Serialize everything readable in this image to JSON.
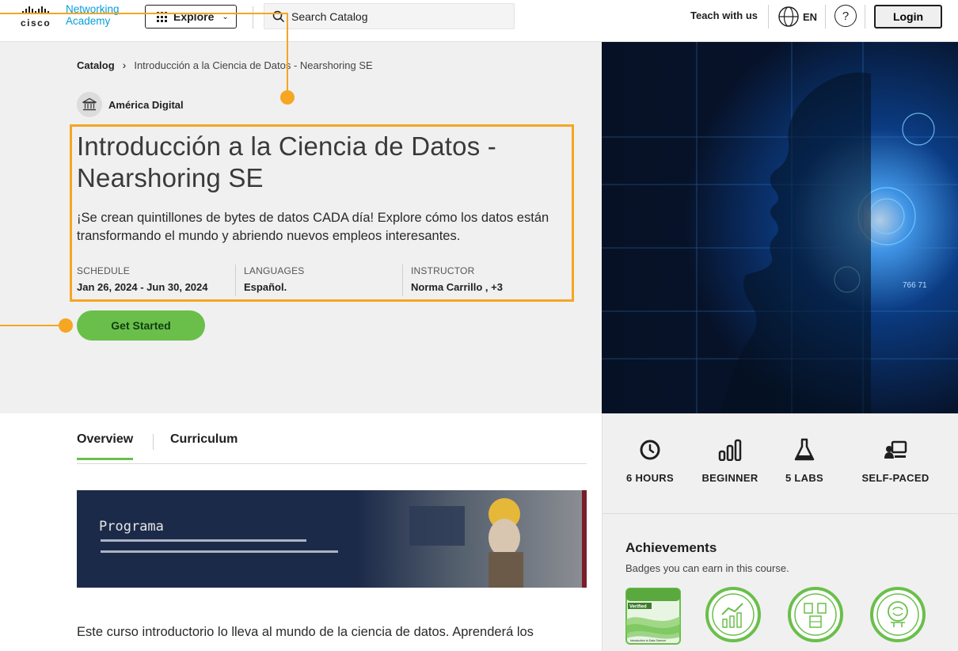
{
  "nav": {
    "logo_brand": "cisco",
    "logo_line1": "Networking",
    "logo_line2": "Academy",
    "explore_label": "Explore",
    "search_placeholder": "Search Catalog",
    "teach_label": "Teach with us",
    "language_label": "EN",
    "help_label": "?",
    "login_label": "Login"
  },
  "breadcrumb": {
    "root": "Catalog",
    "current": "Introducción a la Ciencia de Datos - Nearshoring SE"
  },
  "course": {
    "provider": "América Digital",
    "title": "Introducción a la Ciencia de Datos - Nearshoring SE",
    "description": "¡Se crean quintillones de bytes de datos CADA día! Explore cómo los datos están transformando el mundo y abriendo nuevos empleos interesantes.",
    "schedule_label": "SCHEDULE",
    "schedule_value": "Jan 26, 2024 - Jun 30, 2024",
    "languages_label": "LANGUAGES",
    "languages_value": "Español.",
    "instructor_label": "INSTRUCTOR",
    "instructor_value": "Norma Carrillo , +3",
    "cta_label": "Get Started"
  },
  "hero_image": {
    "overlay_text": "766 71"
  },
  "tabs": [
    {
      "label": "Overview",
      "active": true
    },
    {
      "label": "Curriculum",
      "active": false
    }
  ],
  "banner": {
    "title": "Programa"
  },
  "overview_text": "Este curso introductorio lo lleva al mundo de la ciencia de datos. Aprenderá los",
  "stats": [
    {
      "icon": "clock-icon",
      "label": "6 HOURS"
    },
    {
      "icon": "bar-chart-icon",
      "label": "BEGINNER"
    },
    {
      "icon": "flask-icon",
      "label": "5 LABS"
    },
    {
      "icon": "self-paced-icon",
      "label": "SELF-PACED"
    }
  ],
  "achievements": {
    "title": "Achievements",
    "subtitle": "Badges you can earn in this course.",
    "badge1_tag": "Verified",
    "badge1_caption": "Introduction to Data Science"
  },
  "colors": {
    "accent_green": "#6abf4b",
    "annotation_orange": "#f5a623",
    "cisco_blue": "#049fd9"
  }
}
